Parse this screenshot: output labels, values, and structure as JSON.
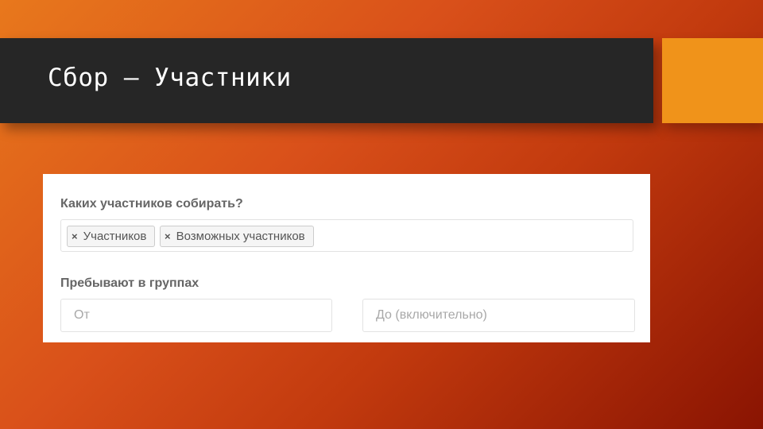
{
  "slide": {
    "title": "Сбор – Участники"
  },
  "form": {
    "question_label": "Каких участников собирать?",
    "tags": [
      {
        "label": "Участников",
        "remove_symbol": "×"
      },
      {
        "label": "Возможных участников",
        "remove_symbol": "×"
      }
    ],
    "groups_label": "Пребывают в группах",
    "from_input": {
      "value": "",
      "placeholder": "От"
    },
    "to_input": {
      "value": "",
      "placeholder": "До (включительно)"
    }
  },
  "colors": {
    "title_bar": "#262626",
    "accent": "#f0931a",
    "panel": "#ffffff"
  }
}
